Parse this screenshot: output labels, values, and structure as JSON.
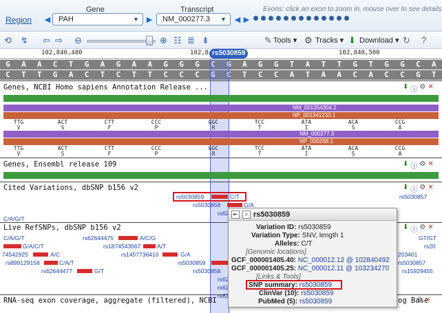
{
  "topbar": {
    "region_link": "Region",
    "gene_label": "Gene",
    "gene_value": "PAH",
    "transcript_label": "Transcript",
    "transcript_value": "NM_000277.3",
    "exon_hint": "Exons: click an exon to zoom in, mouse over to see details",
    "exon_count": 13
  },
  "toolbar": {
    "tools_label": "Tools",
    "tracks_label": "Tracks",
    "download_label": "Download"
  },
  "ruler": {
    "left": "102,840,480",
    "mid": "102,8",
    "right": "102,840,500"
  },
  "selected_variant": "rs5030859",
  "sequence": {
    "top": [
      "G",
      "A",
      "A",
      "C",
      "T",
      "G",
      "A",
      "G",
      "A",
      "A",
      "G",
      "G",
      "G",
      "C",
      "G",
      "A",
      "G",
      "G",
      "T",
      "A",
      "T",
      "T",
      "G",
      "T",
      "G",
      "G",
      "C",
      "A"
    ],
    "bottom": [
      "C",
      "T",
      "T",
      "G",
      "A",
      "C",
      "T",
      "C",
      "T",
      "T",
      "C",
      "C",
      "C",
      "G",
      "C",
      "T",
      "C",
      "C",
      "A",
      "T",
      "A",
      "A",
      "C",
      "A",
      "C",
      "C",
      "G",
      "T"
    ]
  },
  "tracks": {
    "ncbi_title": "Genes, NCBI Homo sapiens Annotation Release ...",
    "nm_label_1": "NM_001354304.2",
    "np_label_1": "NP_001341233.1",
    "nm_label_2": "NM_000277.3",
    "np_label_2": "NP_000268.1",
    "codons_1": [
      "TTG",
      "ACT",
      "CTT",
      "CCC",
      "GGC",
      "TCC",
      "ATA",
      "ACA",
      "CCG"
    ],
    "aa_1": [
      "V",
      "S",
      "F",
      "P",
      "R",
      "T",
      "I",
      "S",
      "A"
    ],
    "codons_2": [
      "TTG",
      "ACT",
      "CTT",
      "CCC",
      "GGC",
      "TCC",
      "ATA",
      "ACA",
      "CCG"
    ],
    "aa_2": [
      "V",
      "S",
      "F",
      "P",
      "R",
      "T",
      "I",
      "S",
      "A"
    ],
    "ensembl_title": "Genes, Ensembl release 109",
    "cited_title": "Cited Variations, dbSNP b156 v2",
    "live_title": "Live RefSNPs, dbSNP b156 v2",
    "rnaseq_title": "RNA-seq exon coverage, aggregate (filtered), NCBI",
    "rnaseq_suffix": "og Base"
  },
  "variants": {
    "cited_left": "rs5030859",
    "cited_right_allele": "C/T",
    "cited_far_right": "rs5030857",
    "cited_second": "rs5030858",
    "cited_second_allele": "G/A",
    "cited_partial": "rs62",
    "live_allele_header": "C/A/G/T",
    "live_row1_left": "C/A/G/T",
    "live_row1_mid": "rs62644475",
    "live_row1_mid_allele": "A/C/G",
    "live_row1_right": "GT/GT",
    "live_row2_left": "G/A/C/T",
    "live_row2_mid": "rs1874543567",
    "live_row2_mid_allele": "A/T",
    "live_row2_right": "rs20",
    "live_row3_left": "74542925",
    "live_row3_left_allele": "A/C",
    "live_row3_mid": "rs1457736410",
    "live_row3_mid_allele": "G/A",
    "live_row3_right": "203401",
    "live_row4_left": "rs899129158",
    "live_row4_left_allele": "C/A/T",
    "live_row4_mid": "rs5030859",
    "live_row4_right": "rs5030857",
    "live_row5_left": "rs62644477",
    "live_row5_left_allele": "G/T",
    "live_row5_mid": "rs5030858",
    "live_row5_right": "rs15929455",
    "live_row6_mid": "rs62",
    "live_row7_mid": "rs62",
    "live_row8_mid": "rs62"
  },
  "popup": {
    "title": "rs5030859",
    "variation_id_label": "Variation ID:",
    "variation_id": "rs5030859",
    "variation_type_label": "Variation Type:",
    "variation_type": "SNV, length 1",
    "alleles_label": "Alleles:",
    "alleles": "C/T",
    "genomic_section": "[Genomic locations]",
    "loc1_label": "GCF_000001405.40:",
    "loc1_value": "NC_000012.12 @ 102840492",
    "loc2_label": "GCF_000001405.25:",
    "loc2_value": "NC_000012.11 @ 103234270",
    "links_section": "[Links & Tools]",
    "snp_summary_label": "SNP summary:",
    "snp_summary_value": "rs5030859",
    "clinvar_label": "ClinVar (10):",
    "clinvar_value": "rs5030859",
    "pubmed_label": "PubMed (5):",
    "pubmed_value": "rs5030859"
  },
  "colors": {
    "gene_green": "#3d9a3d",
    "transcript_red": "#c9613a",
    "protein_purple": "#8d5fc7",
    "highlight_red": "#d4161a",
    "selection_blue": "#4a66d9"
  }
}
